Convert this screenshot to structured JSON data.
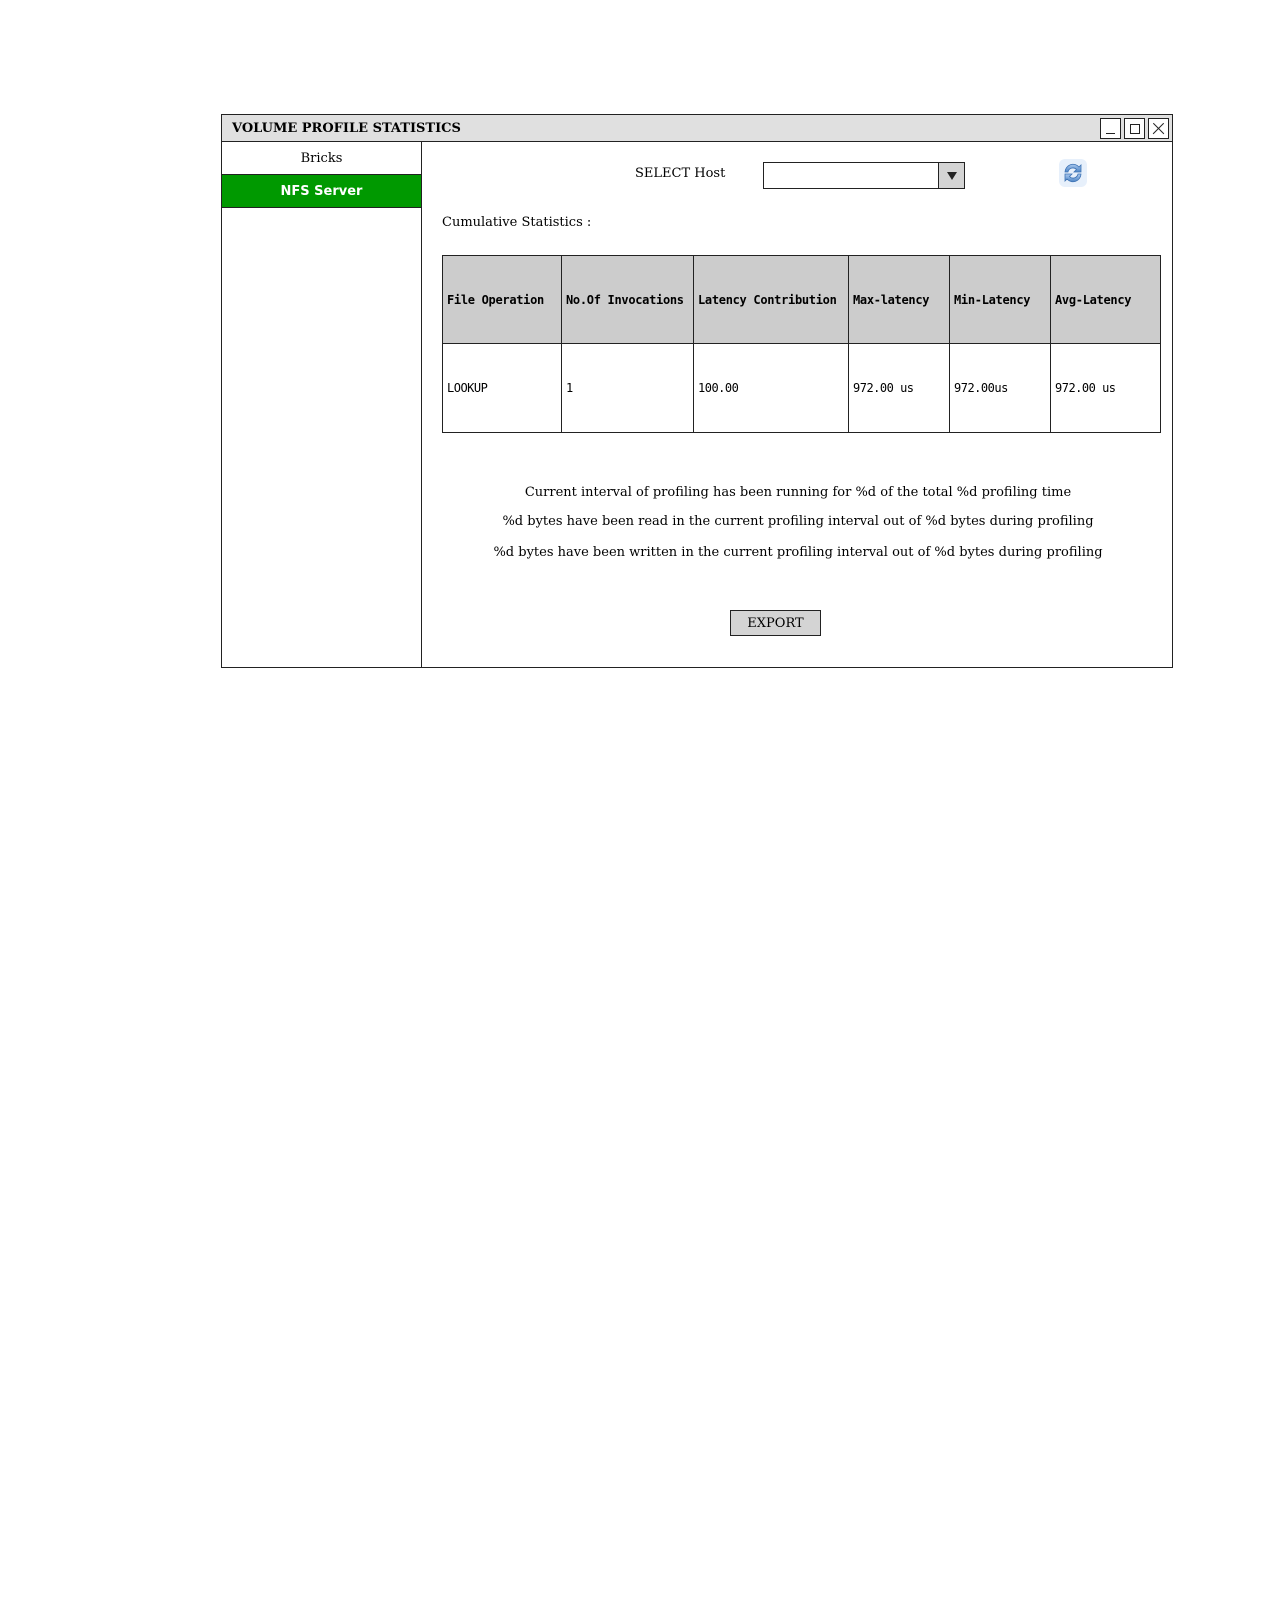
{
  "window": {
    "title": "VOLUME PROFILE STATISTICS"
  },
  "sidebar": {
    "items": [
      {
        "label": "Bricks",
        "active": false
      },
      {
        "label": "NFS Server",
        "active": true,
        "color": "#009900"
      }
    ]
  },
  "host_select": {
    "label": "SELECT Host",
    "value": ""
  },
  "refresh_icon": "refresh-icon",
  "section": {
    "label": "Cumulative Statistics :"
  },
  "table": {
    "columns": [
      "File Operation",
      "No.Of Invocations",
      "Latency Contribution",
      "Max-latency",
      "Min-Latency",
      "Avg-Latency"
    ],
    "rows": [
      [
        "LOOKUP",
        "1",
        "100.00",
        "972.00 us",
        "972.00us",
        "972.00 us"
      ]
    ]
  },
  "info": {
    "line1": "Current interval of profiling has been running for %d of the total %d profiling time",
    "line2": "%d bytes have been read in the current profiling interval out of %d bytes during profiling",
    "line3": "%d bytes have been written in the current profiling interval out of %d bytes during profiling"
  },
  "export_button": {
    "label": "EXPORT"
  }
}
